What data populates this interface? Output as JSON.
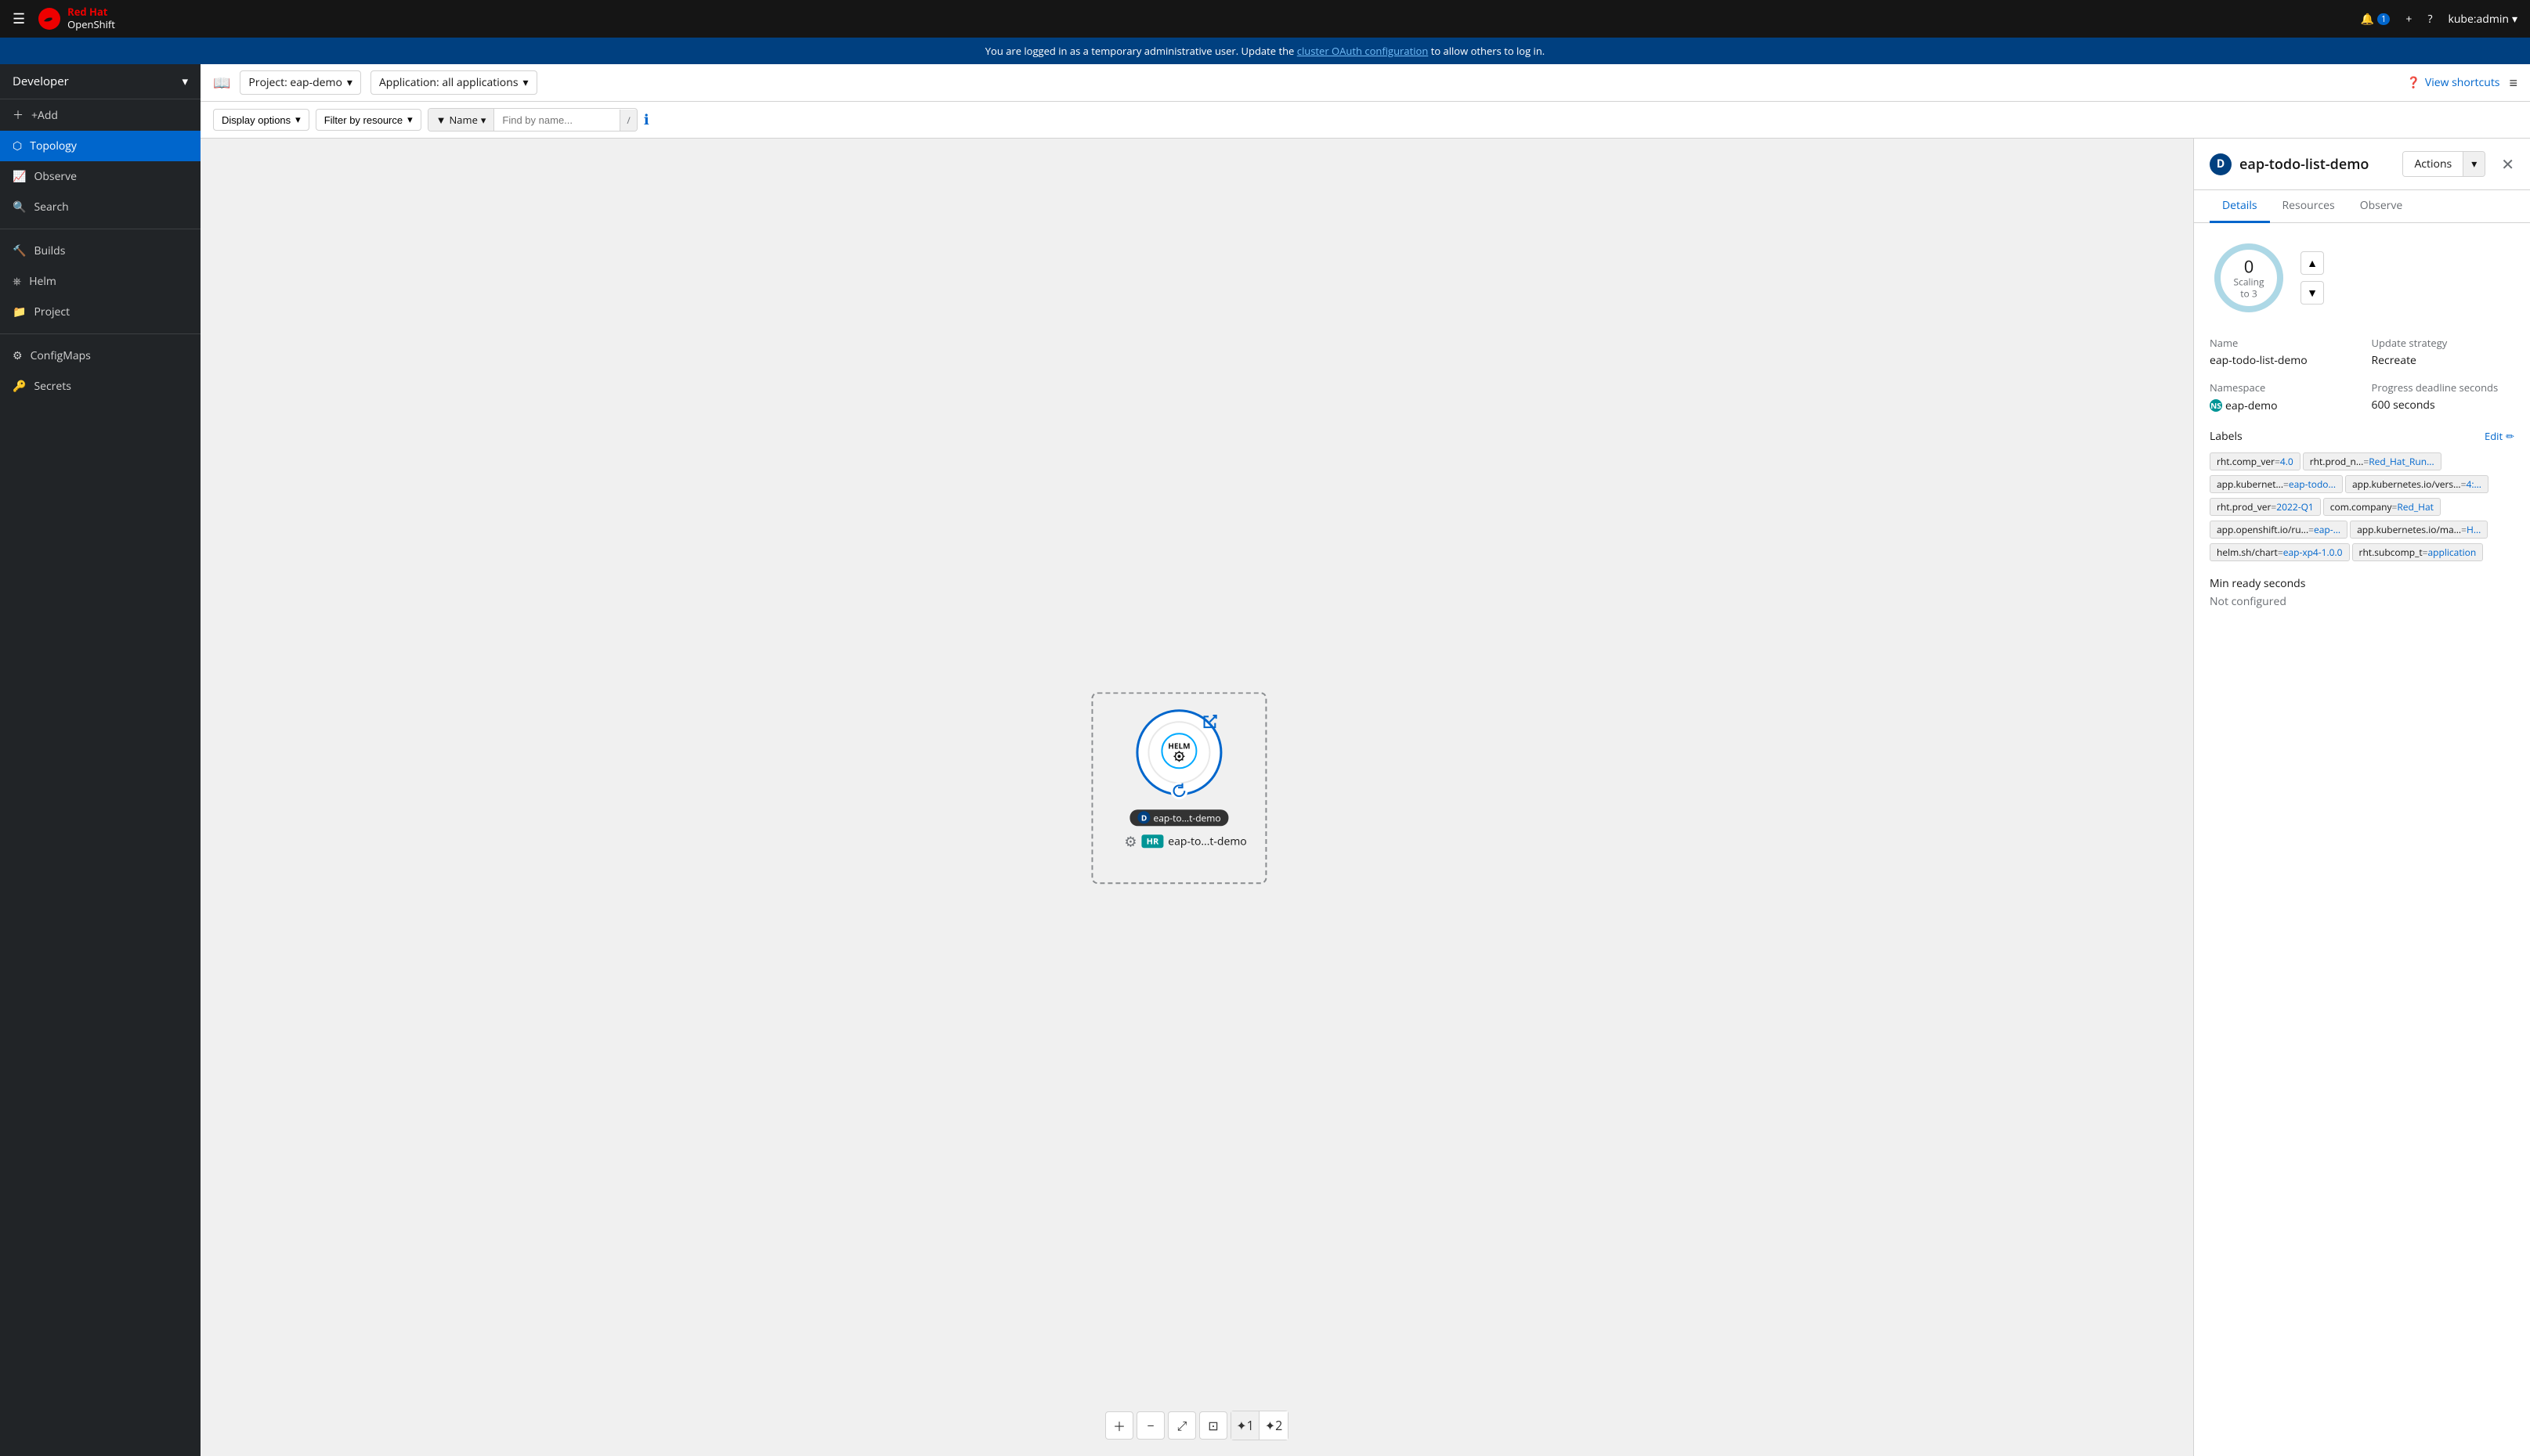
{
  "topnav": {
    "hamburger": "☰",
    "brand_line1": "Red Hat",
    "brand_line2": "OpenShift",
    "bell_count": "1",
    "plus_icon": "+",
    "help_icon": "?",
    "user": "kube:admin"
  },
  "banner": {
    "text_before": "You are logged in as a temporary administrative user. Update the ",
    "link_text": "cluster OAuth configuration",
    "text_after": " to allow others to log in."
  },
  "sidebar": {
    "perspective": "Developer",
    "items": [
      {
        "id": "add",
        "label": "+Add"
      },
      {
        "id": "topology",
        "label": "Topology"
      },
      {
        "id": "observe",
        "label": "Observe"
      },
      {
        "id": "search",
        "label": "Search"
      },
      {
        "id": "builds",
        "label": "Builds"
      },
      {
        "id": "helm",
        "label": "Helm"
      },
      {
        "id": "project",
        "label": "Project"
      },
      {
        "id": "configmaps",
        "label": "ConfigMaps"
      },
      {
        "id": "secrets",
        "label": "Secrets"
      }
    ]
  },
  "subheader": {
    "project_label": "Project: eap-demo",
    "app_label": "Application: all applications",
    "view_shortcuts": "View shortcuts",
    "list_icon": "≡"
  },
  "toolbar": {
    "bookmark_icon": "📖",
    "display_options": "Display options",
    "filter_by_resource": "Filter by resource",
    "filter_icon": "▼",
    "name_label": "Name",
    "find_placeholder": "Find by name...",
    "slash_key": "/",
    "info_icon": "ℹ"
  },
  "canvas": {
    "node_label": "eap-to...t-demo",
    "helm_release_label": "eap-to...t-demo",
    "d_badge": "D",
    "hr_badge": "HR"
  },
  "controls": {
    "zoom_in": "+",
    "zoom_out": "−",
    "fit": "⤢",
    "reset": "⊡",
    "node1_icon": "✦",
    "node1_label": "1",
    "node2_icon": "✦",
    "node2_label": "2"
  },
  "panel": {
    "title": "eap-todo-list-demo",
    "d_badge": "D",
    "actions_label": "Actions",
    "tabs": [
      "Details",
      "Resources",
      "Observe"
    ],
    "active_tab": "Details",
    "scaling": {
      "value": "0",
      "label": "Scaling to 3"
    },
    "details": {
      "name_label": "Name",
      "name_value": "eap-todo-list-demo",
      "update_strategy_label": "Update strategy",
      "update_strategy_value": "Recreate",
      "namespace_label": "Namespace",
      "namespace_value": "eap-demo",
      "progress_deadline_label": "Progress deadline seconds",
      "progress_deadline_value": "600 seconds",
      "labels_label": "Labels",
      "edit_label": "Edit",
      "min_ready_label": "Min ready seconds",
      "not_configured": "Not configured"
    },
    "labels": [
      {
        "key": "rht.comp_ver",
        "eq": "=",
        "val": "4.0"
      },
      {
        "key": "rht.prod_n...",
        "eq": "=",
        "val": "Red_Hat_Run..."
      },
      {
        "key": "app.kubernet...",
        "eq": "=",
        "val": "eap-todo..."
      },
      {
        "key": "app.kubernetes.io/vers...",
        "eq": "=",
        "val": "4:..."
      },
      {
        "key": "rht.prod_ver",
        "eq": "=",
        "val": "2022-Q1"
      },
      {
        "key": "com.company",
        "eq": "=",
        "val": "Red_Hat"
      },
      {
        "key": "app.openshift.io/ru...",
        "eq": "=",
        "val": "eap-..."
      },
      {
        "key": "app.kubernetes.io/ma...",
        "eq": "=",
        "val": "H..."
      },
      {
        "key": "helm.sh/chart",
        "eq": "=",
        "val": "eap-xp4-1.0.0"
      },
      {
        "key": "rht.subcomp_t",
        "eq": "=",
        "val": "application"
      }
    ]
  }
}
